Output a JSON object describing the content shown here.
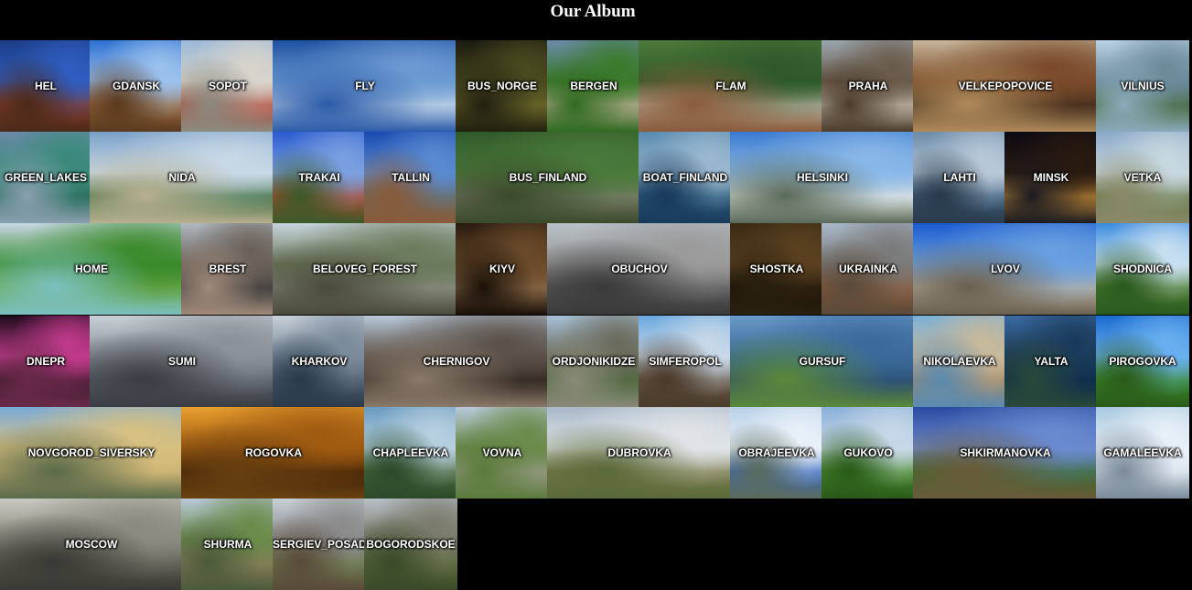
{
  "page": {
    "title": "Our Album"
  },
  "album": {
    "rows": [
      [
        {
          "label": "HEL",
          "span": 1,
          "colors": [
            "#1b3d86",
            "#2f5cbf",
            "#8a3a25",
            "#4a2a1a"
          ]
        },
        {
          "label": "GDANSK",
          "span": 1,
          "colors": [
            "#2c6fd0",
            "#9cc2ee",
            "#9d6a3a",
            "#5a3a20"
          ]
        },
        {
          "label": "SOPOT",
          "span": 1,
          "colors": [
            "#9bb9d8",
            "#d8d4cc",
            "#b24a3a",
            "#8b8b80"
          ]
        },
        {
          "label": "FLY",
          "span": 2,
          "colors": [
            "#1e4fa0",
            "#6c9bd2",
            "#c9d9ea",
            "#2a5aa8"
          ]
        },
        {
          "label": "BUS_NORGE",
          "span": 1,
          "colors": [
            "#1a1a10",
            "#4a4a20",
            "#6f6a2a",
            "#202010"
          ]
        },
        {
          "label": "BERGEN",
          "span": 1,
          "colors": [
            "#6a8aa8",
            "#3a7a2a",
            "#c4b09a",
            "#2e6a20"
          ]
        },
        {
          "label": "FLAM",
          "span": 2,
          "colors": [
            "#4c7a3a",
            "#2e5a2a",
            "#b8b2a0",
            "#8a5a3a"
          ]
        },
        {
          "label": "PRAHA",
          "span": 1,
          "colors": [
            "#9aa6ae",
            "#6a5a4a",
            "#c8c0b0",
            "#4a3a2a"
          ]
        },
        {
          "label": "VELKEPOPOVICE",
          "span": 2,
          "colors": [
            "#c8b69a",
            "#7a4a2a",
            "#3a2a1a",
            "#b08a5a"
          ]
        },
        {
          "label": "VILNIUS",
          "span": 1,
          "colors": [
            "#bcd2e6",
            "#6a8a9a",
            "#4a6a3a",
            "#8aaabc"
          ]
        }
      ],
      [
        {
          "label": "GREEN_LAKES",
          "span": 1,
          "colors": [
            "#6a8aa8",
            "#3a8a7a",
            "#2a6a5a",
            "#8aa0b0"
          ]
        },
        {
          "label": "NIDA",
          "span": 2,
          "colors": [
            "#7aa0c8",
            "#c8d8e6",
            "#3a6a3a",
            "#b8b090"
          ]
        },
        {
          "label": "TRAKAI",
          "span": 1,
          "colors": [
            "#2a5ad0",
            "#7aa0e0",
            "#b04a2a",
            "#3a5a2a"
          ]
        },
        {
          "label": "TALLIN",
          "span": 1,
          "colors": [
            "#1a4ab0",
            "#5a8ad0",
            "#6a6a5a",
            "#8a5a3a"
          ]
        },
        {
          "label": "BUS_FINLAND",
          "span": 2,
          "colors": [
            "#2e5a2a",
            "#4a7a3a",
            "#7a7a6a",
            "#3a4a2a"
          ]
        },
        {
          "label": "BOAT_FINLAND",
          "span": 1,
          "colors": [
            "#5a8ab0",
            "#9ab8d0",
            "#2a5a7a",
            "#1a3a5a"
          ]
        },
        {
          "label": "HELSINKI",
          "span": 2,
          "colors": [
            "#3a7ad0",
            "#8ab8e8",
            "#e8e8e0",
            "#5a6a5a"
          ]
        },
        {
          "label": "LAHTI",
          "span": 1,
          "colors": [
            "#6a8aa8",
            "#b8c8d8",
            "#3a5a7a",
            "#2a3a4a"
          ]
        },
        {
          "label": "MINSK",
          "span": 1,
          "colors": [
            "#0a0a14",
            "#2a1a10",
            "#c08a3a",
            "#1a1a20"
          ]
        },
        {
          "label": "VETKA",
          "span": 1,
          "colors": [
            "#8aa8c8",
            "#c8d8e0",
            "#6a7a4a",
            "#8a8a6a"
          ]
        }
      ],
      [
        {
          "label": "HOME",
          "span": 2,
          "colors": [
            "#c8d8e6",
            "#3a8a2a",
            "#6aa84a",
            "#7ac0c0"
          ]
        },
        {
          "label": "BREST",
          "span": 1,
          "colors": [
            "#b0b8c0",
            "#6a6058",
            "#3a3a3a",
            "#a08a7a"
          ]
        },
        {
          "label": "BELOVEG_FOREST",
          "span": 2,
          "colors": [
            "#c8d4de",
            "#6a7a5a",
            "#8a8a80",
            "#4a4a3a"
          ]
        },
        {
          "label": "KIYV",
          "span": 1,
          "colors": [
            "#2a1a10",
            "#6a4a2a",
            "#8a6a4a",
            "#1a1008"
          ]
        },
        {
          "label": "OBUCHOV",
          "span": 2,
          "colors": [
            "#b8c0c8",
            "#9a9a9a",
            "#5a5a5a",
            "#3a3a3a"
          ]
        },
        {
          "label": "SHOSTKA",
          "span": 1,
          "colors": [
            "#3a2a14",
            "#5a4020",
            "#1a1208",
            "#2a2010"
          ]
        },
        {
          "label": "UKRAINKA",
          "span": 1,
          "colors": [
            "#a8b8c8",
            "#7a7a7a",
            "#8a5a3a",
            "#5a4a3a"
          ]
        },
        {
          "label": "LVOV",
          "span": 2,
          "colors": [
            "#1a5ad0",
            "#6aa0e0",
            "#b8b0a0",
            "#6a6050"
          ]
        },
        {
          "label": "SHODNICA",
          "span": 1,
          "colors": [
            "#3a8ae0",
            "#c8e0f0",
            "#4a7a2a",
            "#2a5a20"
          ]
        }
      ],
      [
        {
          "label": "DNEPR",
          "span": 1,
          "colors": [
            "#1a0a1a",
            "#c03a8a",
            "#3a1a2a",
            "#6a2a4a"
          ]
        },
        {
          "label": "SUMI",
          "span": 2,
          "colors": [
            "#c8d0d8",
            "#8a9098",
            "#5a6068",
            "#3a3e44"
          ]
        },
        {
          "label": "KHARKOV",
          "span": 1,
          "colors": [
            "#c8d0d8",
            "#7a8a9a",
            "#4a5a6a",
            "#2a3a4a"
          ]
        },
        {
          "label": "CHERNIGOV",
          "span": 2,
          "colors": [
            "#b8c8d8",
            "#5a5048",
            "#2a2018",
            "#8a7a6a"
          ]
        },
        {
          "label": "ORDJONIKIDZE",
          "span": 1,
          "colors": [
            "#a8c0d8",
            "#6a6a5a",
            "#4a6a3a",
            "#8a8a7a"
          ]
        },
        {
          "label": "SIMFEROPOL",
          "span": 1,
          "colors": [
            "#6aa8e0",
            "#c8d8e8",
            "#6a5a4a",
            "#4a3a2a"
          ]
        },
        {
          "label": "GURSUF",
          "span": 2,
          "colors": [
            "#6a9ac8",
            "#3a6a9a",
            "#2a4a6a",
            "#5a8a3a"
          ]
        },
        {
          "label": "NIKOLAEVKA",
          "span": 1,
          "colors": [
            "#7ab0d8",
            "#c8b89a",
            "#a08a6a",
            "#5a8ab0"
          ]
        },
        {
          "label": "YALTA",
          "span": 1,
          "colors": [
            "#3a6aa0",
            "#1a3a5a",
            "#0a2a4a",
            "#2a4a3a"
          ]
        },
        {
          "label": "PIROGOVKA",
          "span": 1,
          "colors": [
            "#1a6ad0",
            "#6ab0f0",
            "#3a8a2a",
            "#2a5a1a"
          ]
        }
      ],
      [
        {
          "label": "NOVGOROD_SIVERSKY",
          "span": 2,
          "colors": [
            "#7aaad8",
            "#d8c080",
            "#c8b070",
            "#5a6a4a"
          ]
        },
        {
          "label": "ROGOVKA",
          "span": 2,
          "colors": [
            "#e8a030",
            "#a05a10",
            "#3a2008",
            "#6a4010"
          ]
        },
        {
          "label": "CHAPLEEVKA",
          "span": 1,
          "colors": [
            "#6a9ac0",
            "#b8d0e0",
            "#4a6a3a",
            "#2a4a2a"
          ]
        },
        {
          "label": "VOVNA",
          "span": 1,
          "colors": [
            "#b8c8d8",
            "#6a8a4a",
            "#9a9a8a",
            "#5a7a3a"
          ]
        },
        {
          "label": "DUBROVKA",
          "span": 2,
          "colors": [
            "#a8b8c8",
            "#e0e4e8",
            "#7a7a4a",
            "#5a6a3a"
          ]
        },
        {
          "label": "OBRAJEEVKA",
          "span": 1,
          "colors": [
            "#b8d0e8",
            "#e8f0f8",
            "#3a6ac0",
            "#5a6a5a"
          ]
        },
        {
          "label": "GUKOVO",
          "span": 1,
          "colors": [
            "#8ab0d8",
            "#c8d8e8",
            "#4a8a2a",
            "#2a5a1a"
          ]
        },
        {
          "label": "SHKIRMANOVKA",
          "span": 2,
          "colors": [
            "#2a4aa0",
            "#6a8ad0",
            "#3a6a2a",
            "#6a5a3a"
          ]
        },
        {
          "label": "GAMALEEVKA",
          "span": 1,
          "colors": [
            "#a8c8e0",
            "#e8f0f8",
            "#d8e0e8",
            "#7a8a9a"
          ]
        }
      ],
      [
        {
          "label": "MOSCOW",
          "span": 2,
          "colors": [
            "#c8c8c0",
            "#8a8a80",
            "#5a5a50",
            "#3a3a34"
          ]
        },
        {
          "label": "SHURMA",
          "span": 1,
          "colors": [
            "#b8c8d8",
            "#6a8a4a",
            "#8a7a5a",
            "#4a5a3a"
          ]
        },
        {
          "label": "SERGIEV_POSAD",
          "span": 1,
          "colors": [
            "#c8d0d8",
            "#8a8a8a",
            "#6a7a4a",
            "#5a4a3a"
          ]
        },
        {
          "label": "BOGORODSKOE",
          "span": 1,
          "colors": [
            "#b8c0c8",
            "#7a7a6a",
            "#5a6a3a",
            "#3a4a2a"
          ]
        }
      ]
    ]
  }
}
